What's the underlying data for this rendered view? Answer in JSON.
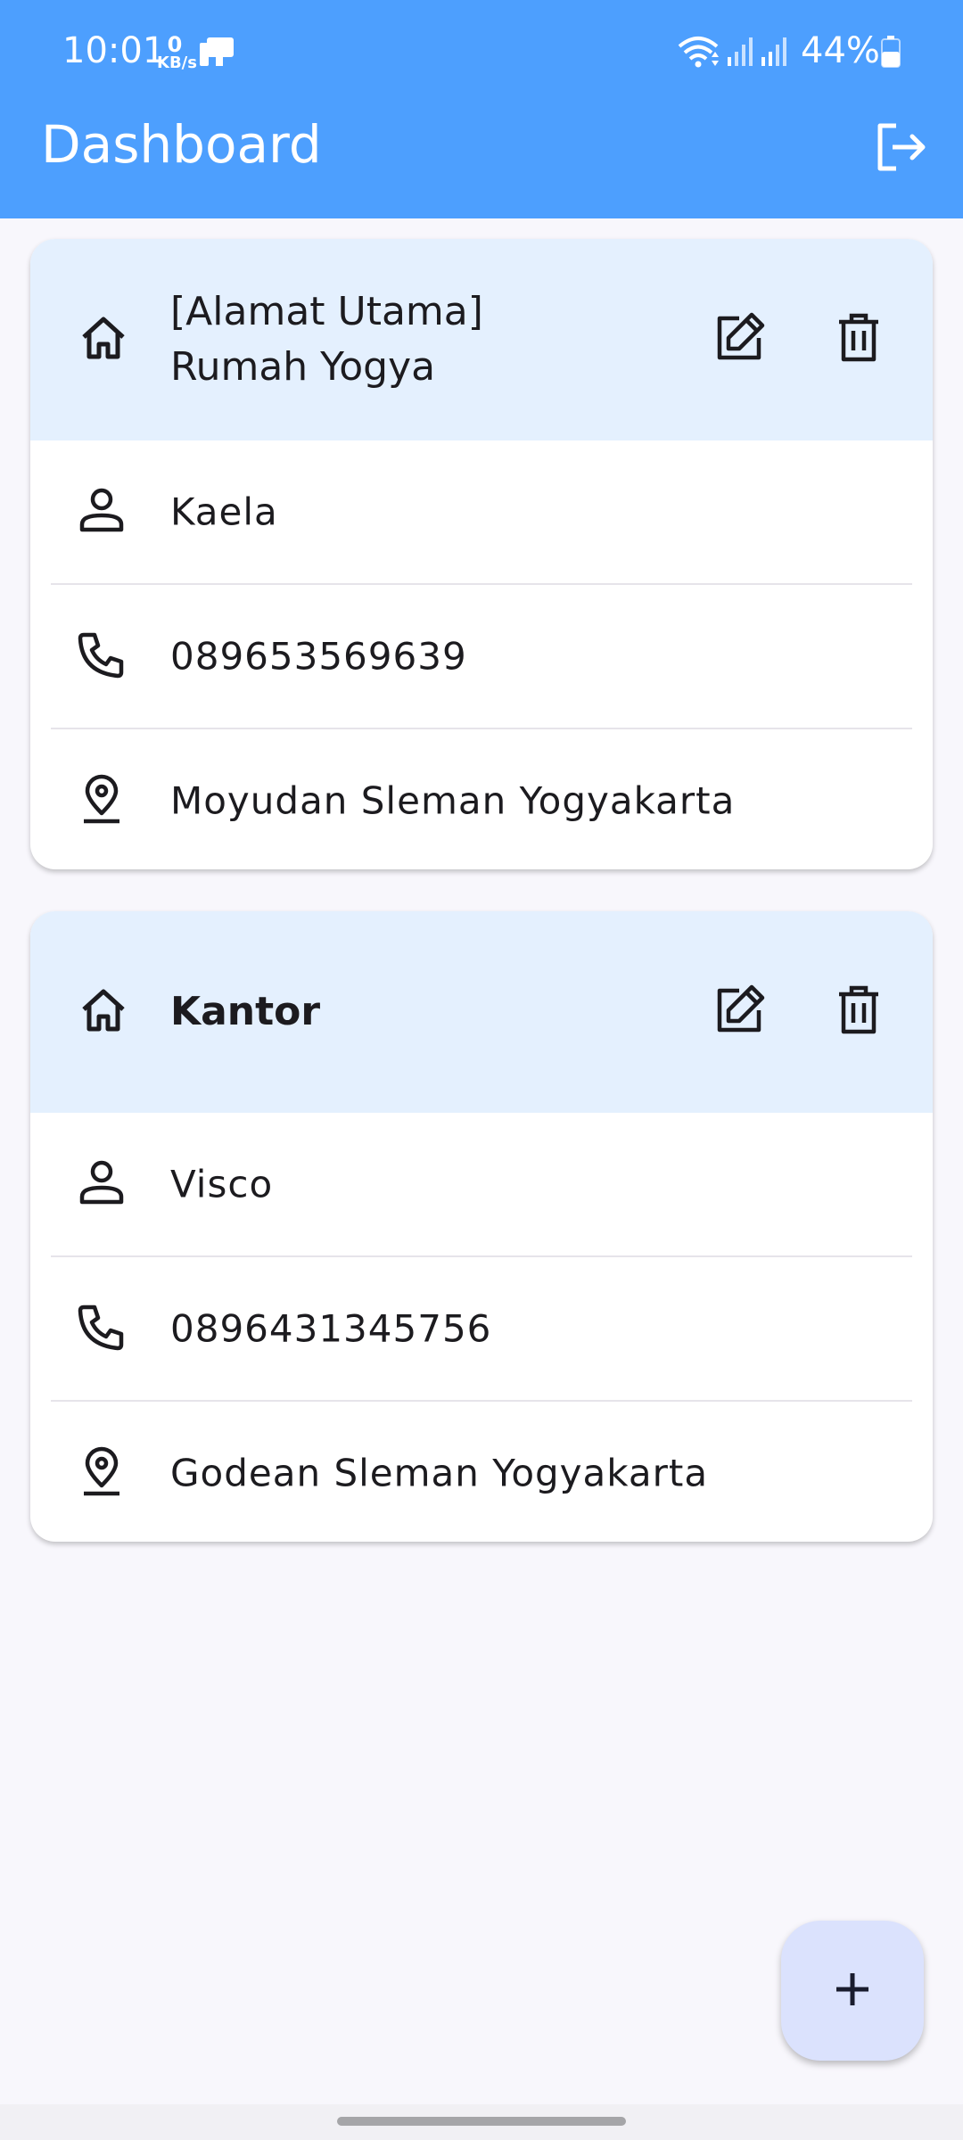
{
  "status_bar": {
    "time": "10:01",
    "net_speed_value": "0",
    "net_speed_unit": "KB/s",
    "battery": "44%"
  },
  "app_bar": {
    "title": "Dashboard",
    "logout_icon": "logout-icon"
  },
  "addresses": [
    {
      "title_line1": "[Alamat Utama]",
      "title_line2": "Rumah Yogya",
      "name": "Kaela",
      "phone": "089653569639",
      "address": "Moyudan Sleman Yogyakarta"
    },
    {
      "title_line1": "Kantor",
      "title_line2": "",
      "name": "Visco",
      "phone": "0896431345756",
      "address": "Godean Sleman Yogyakarta"
    }
  ],
  "icons": {
    "home": "home-icon",
    "edit": "edit-icon",
    "delete": "delete-icon",
    "person": "person-icon",
    "phone": "phone-icon",
    "location": "location-pin-icon",
    "add": "add-icon"
  },
  "colors": {
    "app_bar": "#4d9ffe",
    "card_header": "#e4f0fe",
    "fab": "#dbe2fd",
    "background": "#f8f7fc"
  }
}
